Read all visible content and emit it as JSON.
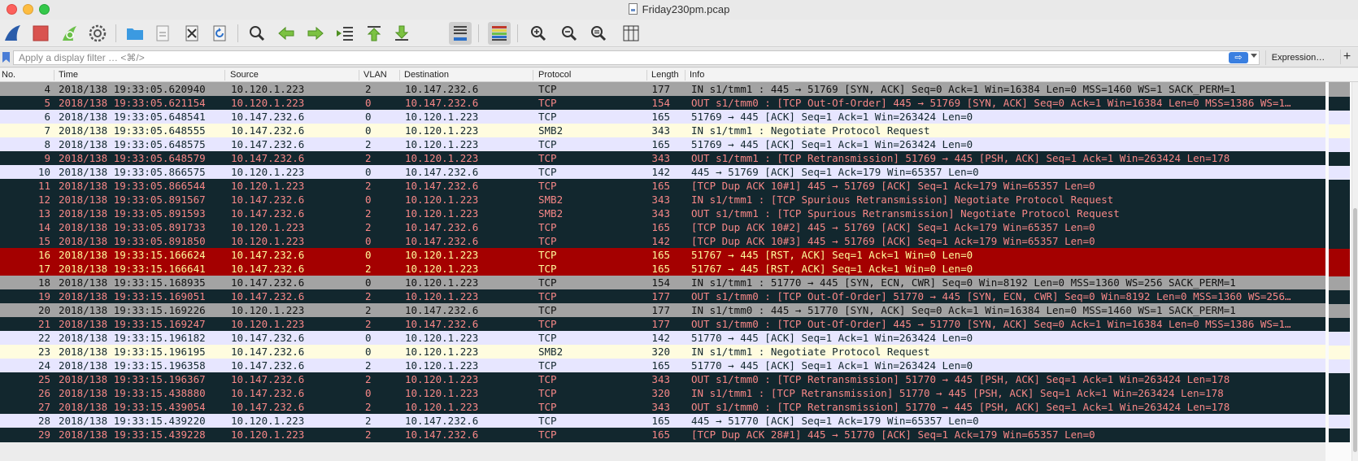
{
  "window": {
    "title": "Friday230pm.pcap"
  },
  "toolbar": {
    "icons": [
      "shark-fin-icon",
      "stop-capture-icon",
      "restart-capture-icon",
      "capture-options-icon",
      "open-file-icon",
      "save-file-icon",
      "close-file-icon",
      "reload-file-icon",
      "find-packet-icon",
      "go-back-icon",
      "go-forward-icon",
      "go-to-packet-icon",
      "first-packet-icon",
      "last-packet-icon",
      "autoscroll-icon",
      "colorize-icon",
      "zoom-in-icon",
      "zoom-out-icon",
      "zoom-normal-icon",
      "resize-columns-icon"
    ]
  },
  "filter": {
    "placeholder": "Apply a display filter … <⌘/>",
    "value": "",
    "apply_glyph": "⇨",
    "expression_label": "Expression…",
    "add_label": "+"
  },
  "columns": {
    "no": "No.",
    "time": "Time",
    "source": "Source",
    "vlan": "VLAN",
    "destination": "Destination",
    "protocol": "Protocol",
    "length": "Length",
    "info": "Info"
  },
  "colors": {
    "gray": "#a3a3a3",
    "dark": "#12272e",
    "dark_text": "#f78787",
    "lavender": "#e7e6ff",
    "yellow": "#fffcdf",
    "red": "#a40000",
    "red_text": "#fffc9c"
  },
  "packets": [
    {
      "no": "4",
      "time": "2018/138 19:33:05.620940",
      "src": "10.120.1.223",
      "vlan": "2",
      "dst": "10.147.232.6",
      "proto": "TCP",
      "len": "177",
      "info": "IN  s1/tmm1 : 445 → 51769 [SYN, ACK] Seq=0 Ack=1 Win=16384 Len=0 MSS=1460 WS=1 SACK_PERM=1",
      "style": "gray"
    },
    {
      "no": "5",
      "time": "2018/138 19:33:05.621154",
      "src": "10.120.1.223",
      "vlan": "0",
      "dst": "10.147.232.6",
      "proto": "TCP",
      "len": "154",
      "info": "OUT s1/tmm0 : [TCP Out-Of-Order] 445 → 51769 [SYN, ACK] Seq=0 Ack=1 Win=16384 Len=0 MSS=1386 WS=1…",
      "style": "dark"
    },
    {
      "no": "6",
      "time": "2018/138 19:33:05.648541",
      "src": "10.147.232.6",
      "vlan": "0",
      "dst": "10.120.1.223",
      "proto": "TCP",
      "len": "165",
      "info": "51769 → 445 [ACK] Seq=1 Ack=1 Win=263424 Len=0",
      "style": "lav"
    },
    {
      "no": "7",
      "time": "2018/138 19:33:05.648555",
      "src": "10.147.232.6",
      "vlan": "0",
      "dst": "10.120.1.223",
      "proto": "SMB2",
      "len": "343",
      "info": "IN  s1/tmm1 : Negotiate Protocol Request",
      "style": "yel"
    },
    {
      "no": "8",
      "time": "2018/138 19:33:05.648575",
      "src": "10.147.232.6",
      "vlan": "2",
      "dst": "10.120.1.223",
      "proto": "TCP",
      "len": "165",
      "info": "51769 → 445 [ACK] Seq=1 Ack=1 Win=263424 Len=0",
      "style": "lav"
    },
    {
      "no": "9",
      "time": "2018/138 19:33:05.648579",
      "src": "10.147.232.6",
      "vlan": "2",
      "dst": "10.120.1.223",
      "proto": "TCP",
      "len": "343",
      "info": "OUT s1/tmm1 : [TCP Retransmission] 51769 → 445 [PSH, ACK] Seq=1 Ack=1 Win=263424 Len=178",
      "style": "dark"
    },
    {
      "no": "10",
      "time": "2018/138 19:33:05.866575",
      "src": "10.120.1.223",
      "vlan": "0",
      "dst": "10.147.232.6",
      "proto": "TCP",
      "len": "142",
      "info": "445 → 51769 [ACK] Seq=1 Ack=179 Win=65357 Len=0",
      "style": "lav"
    },
    {
      "no": "11",
      "time": "2018/138 19:33:05.866544",
      "src": "10.120.1.223",
      "vlan": "2",
      "dst": "10.147.232.6",
      "proto": "TCP",
      "len": "165",
      "info": "[TCP Dup ACK 10#1] 445 → 51769 [ACK] Seq=1 Ack=179 Win=65357 Len=0",
      "style": "dark"
    },
    {
      "no": "12",
      "time": "2018/138 19:33:05.891567",
      "src": "10.147.232.6",
      "vlan": "0",
      "dst": "10.120.1.223",
      "proto": "SMB2",
      "len": "343",
      "info": "IN  s1/tmm1 : [TCP Spurious Retransmission] Negotiate Protocol Request",
      "style": "dark"
    },
    {
      "no": "13",
      "time": "2018/138 19:33:05.891593",
      "src": "10.147.232.6",
      "vlan": "2",
      "dst": "10.120.1.223",
      "proto": "SMB2",
      "len": "343",
      "info": "OUT s1/tmm1 : [TCP Spurious Retransmission] Negotiate Protocol Request",
      "style": "dark"
    },
    {
      "no": "14",
      "time": "2018/138 19:33:05.891733",
      "src": "10.120.1.223",
      "vlan": "2",
      "dst": "10.147.232.6",
      "proto": "TCP",
      "len": "165",
      "info": "[TCP Dup ACK 10#2] 445 → 51769 [ACK] Seq=1 Ack=179 Win=65357 Len=0",
      "style": "dark"
    },
    {
      "no": "15",
      "time": "2018/138 19:33:05.891850",
      "src": "10.120.1.223",
      "vlan": "0",
      "dst": "10.147.232.6",
      "proto": "TCP",
      "len": "142",
      "info": "[TCP Dup ACK 10#3] 445 → 51769 [ACK] Seq=1 Ack=179 Win=65357 Len=0",
      "style": "dark"
    },
    {
      "no": "16",
      "time": "2018/138 19:33:15.166624",
      "src": "10.147.232.6",
      "vlan": "0",
      "dst": "10.120.1.223",
      "proto": "TCP",
      "len": "165",
      "info": "51767 → 445 [RST, ACK] Seq=1 Ack=1 Win=0 Len=0",
      "style": "red"
    },
    {
      "no": "17",
      "time": "2018/138 19:33:15.166641",
      "src": "10.147.232.6",
      "vlan": "2",
      "dst": "10.120.1.223",
      "proto": "TCP",
      "len": "165",
      "info": "51767 → 445 [RST, ACK] Seq=1 Ack=1 Win=0 Len=0",
      "style": "red"
    },
    {
      "no": "18",
      "time": "2018/138 19:33:15.168935",
      "src": "10.147.232.6",
      "vlan": "0",
      "dst": "10.120.1.223",
      "proto": "TCP",
      "len": "154",
      "info": "IN  s1/tmm1 : 51770 → 445 [SYN, ECN, CWR] Seq=0 Win=8192 Len=0 MSS=1360 WS=256 SACK_PERM=1",
      "style": "gray"
    },
    {
      "no": "19",
      "time": "2018/138 19:33:15.169051",
      "src": "10.147.232.6",
      "vlan": "2",
      "dst": "10.120.1.223",
      "proto": "TCP",
      "len": "177",
      "info": "OUT s1/tmm0 : [TCP Out-Of-Order] 51770 → 445 [SYN, ECN, CWR] Seq=0 Win=8192 Len=0 MSS=1360 WS=256…",
      "style": "dark"
    },
    {
      "no": "20",
      "time": "2018/138 19:33:15.169226",
      "src": "10.120.1.223",
      "vlan": "2",
      "dst": "10.147.232.6",
      "proto": "TCP",
      "len": "177",
      "info": "IN  s1/tmm0 : 445 → 51770 [SYN, ACK] Seq=0 Ack=1 Win=16384 Len=0 MSS=1460 WS=1 SACK_PERM=1",
      "style": "gray"
    },
    {
      "no": "21",
      "time": "2018/138 19:33:15.169247",
      "src": "10.120.1.223",
      "vlan": "2",
      "dst": "10.147.232.6",
      "proto": "TCP",
      "len": "177",
      "info": "OUT s1/tmm0 : [TCP Out-Of-Order] 445 → 51770 [SYN, ACK] Seq=0 Ack=1 Win=16384 Len=0 MSS=1386 WS=1…",
      "style": "dark"
    },
    {
      "no": "22",
      "time": "2018/138 19:33:15.196182",
      "src": "10.147.232.6",
      "vlan": "0",
      "dst": "10.120.1.223",
      "proto": "TCP",
      "len": "142",
      "info": "51770 → 445 [ACK] Seq=1 Ack=1 Win=263424 Len=0",
      "style": "lav"
    },
    {
      "no": "23",
      "time": "2018/138 19:33:15.196195",
      "src": "10.147.232.6",
      "vlan": "0",
      "dst": "10.120.1.223",
      "proto": "SMB2",
      "len": "320",
      "info": "IN  s1/tmm1 : Negotiate Protocol Request",
      "style": "yel"
    },
    {
      "no": "24",
      "time": "2018/138 19:33:15.196358",
      "src": "10.147.232.6",
      "vlan": "2",
      "dst": "10.120.1.223",
      "proto": "TCP",
      "len": "165",
      "info": "51770 → 445 [ACK] Seq=1 Ack=1 Win=263424 Len=0",
      "style": "lav"
    },
    {
      "no": "25",
      "time": "2018/138 19:33:15.196367",
      "src": "10.147.232.6",
      "vlan": "2",
      "dst": "10.120.1.223",
      "proto": "TCP",
      "len": "343",
      "info": "OUT s1/tmm0 : [TCP Retransmission] 51770 → 445 [PSH, ACK] Seq=1 Ack=1 Win=263424 Len=178",
      "style": "dark"
    },
    {
      "no": "26",
      "time": "2018/138 19:33:15.438880",
      "src": "10.147.232.6",
      "vlan": "0",
      "dst": "10.120.1.223",
      "proto": "TCP",
      "len": "320",
      "info": "IN  s1/tmm1 : [TCP Retransmission] 51770 → 445 [PSH, ACK] Seq=1 Ack=1 Win=263424 Len=178",
      "style": "dark"
    },
    {
      "no": "27",
      "time": "2018/138 19:33:15.439054",
      "src": "10.147.232.6",
      "vlan": "2",
      "dst": "10.120.1.223",
      "proto": "TCP",
      "len": "343",
      "info": "OUT s1/tmm0 : [TCP Retransmission] 51770 → 445 [PSH, ACK] Seq=1 Ack=1 Win=263424 Len=178",
      "style": "dark"
    },
    {
      "no": "28",
      "time": "2018/138 19:33:15.439220",
      "src": "10.120.1.223",
      "vlan": "2",
      "dst": "10.147.232.6",
      "proto": "TCP",
      "len": "165",
      "info": "445 → 51770 [ACK] Seq=1 Ack=179 Win=65357 Len=0",
      "style": "lav"
    },
    {
      "no": "29",
      "time": "2018/138 19:33:15.439228",
      "src": "10.120.1.223",
      "vlan": "2",
      "dst": "10.147.232.6",
      "proto": "TCP",
      "len": "165",
      "info": "[TCP Dup ACK 28#1] 445 → 51770 [ACK] Seq=1 Ack=179 Win=65357 Len=0",
      "style": "dark"
    }
  ]
}
